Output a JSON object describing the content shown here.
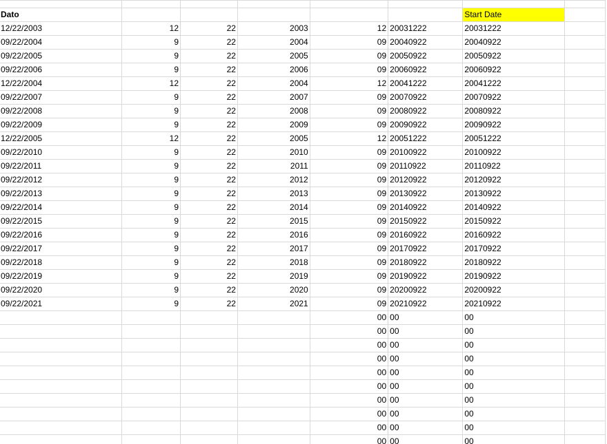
{
  "sheet": {
    "col_a_header": "Dato",
    "col_g_header": "Start Date",
    "highlight_color": "#ffff00",
    "rows": [
      {
        "a": "12/22/2003",
        "b": "12",
        "c": "22",
        "d": "2003",
        "e": "12",
        "f": "20031222",
        "g": "20031222"
      },
      {
        "a": "09/22/2004",
        "b": "9",
        "c": "22",
        "d": "2004",
        "e": "09",
        "f": "20040922",
        "g": "20040922"
      },
      {
        "a": "09/22/2005",
        "b": "9",
        "c": "22",
        "d": "2005",
        "e": "09",
        "f": "20050922",
        "g": "20050922"
      },
      {
        "a": "09/22/2006",
        "b": "9",
        "c": "22",
        "d": "2006",
        "e": "09",
        "f": "20060922",
        "g": "20060922"
      },
      {
        "a": "12/22/2004",
        "b": "12",
        "c": "22",
        "d": "2004",
        "e": "12",
        "f": "20041222",
        "g": "20041222"
      },
      {
        "a": "09/22/2007",
        "b": "9",
        "c": "22",
        "d": "2007",
        "e": "09",
        "f": "20070922",
        "g": "20070922"
      },
      {
        "a": "09/22/2008",
        "b": "9",
        "c": "22",
        "d": "2008",
        "e": "09",
        "f": "20080922",
        "g": "20080922"
      },
      {
        "a": "09/22/2009",
        "b": "9",
        "c": "22",
        "d": "2009",
        "e": "09",
        "f": "20090922",
        "g": "20090922"
      },
      {
        "a": "12/22/2005",
        "b": "12",
        "c": "22",
        "d": "2005",
        "e": "12",
        "f": "20051222",
        "g": "20051222"
      },
      {
        "a": "09/22/2010",
        "b": "9",
        "c": "22",
        "d": "2010",
        "e": "09",
        "f": "20100922",
        "g": "20100922"
      },
      {
        "a": "09/22/2011",
        "b": "9",
        "c": "22",
        "d": "2011",
        "e": "09",
        "f": "20110922",
        "g": "20110922"
      },
      {
        "a": "09/22/2012",
        "b": "9",
        "c": "22",
        "d": "2012",
        "e": "09",
        "f": "20120922",
        "g": "20120922"
      },
      {
        "a": "09/22/2013",
        "b": "9",
        "c": "22",
        "d": "2013",
        "e": "09",
        "f": "20130922",
        "g": "20130922"
      },
      {
        "a": "09/22/2014",
        "b": "9",
        "c": "22",
        "d": "2014",
        "e": "09",
        "f": "20140922",
        "g": "20140922"
      },
      {
        "a": "09/22/2015",
        "b": "9",
        "c": "22",
        "d": "2015",
        "e": "09",
        "f": "20150922",
        "g": "20150922"
      },
      {
        "a": "09/22/2016",
        "b": "9",
        "c": "22",
        "d": "2016",
        "e": "09",
        "f": "20160922",
        "g": "20160922"
      },
      {
        "a": "09/22/2017",
        "b": "9",
        "c": "22",
        "d": "2017",
        "e": "09",
        "f": "20170922",
        "g": "20170922"
      },
      {
        "a": "09/22/2018",
        "b": "9",
        "c": "22",
        "d": "2018",
        "e": "09",
        "f": "20180922",
        "g": "20180922"
      },
      {
        "a": "09/22/2019",
        "b": "9",
        "c": "22",
        "d": "2019",
        "e": "09",
        "f": "20190922",
        "g": "20190922"
      },
      {
        "a": "09/22/2020",
        "b": "9",
        "c": "22",
        "d": "2020",
        "e": "09",
        "f": "20200922",
        "g": "20200922"
      },
      {
        "a": "09/22/2021",
        "b": "9",
        "c": "22",
        "d": "2021",
        "e": "09",
        "f": "20210922",
        "g": "20210922"
      },
      {
        "a": "",
        "b": "",
        "c": "",
        "d": "",
        "e": "00",
        "f": "00",
        "g": "00"
      },
      {
        "a": "",
        "b": "",
        "c": "",
        "d": "",
        "e": "00",
        "f": "00",
        "g": "00"
      },
      {
        "a": "",
        "b": "",
        "c": "",
        "d": "",
        "e": "00",
        "f": "00",
        "g": "00"
      },
      {
        "a": "",
        "b": "",
        "c": "",
        "d": "",
        "e": "00",
        "f": "00",
        "g": "00"
      },
      {
        "a": "",
        "b": "",
        "c": "",
        "d": "",
        "e": "00",
        "f": "00",
        "g": "00"
      },
      {
        "a": "",
        "b": "",
        "c": "",
        "d": "",
        "e": "00",
        "f": "00",
        "g": "00"
      },
      {
        "a": "",
        "b": "",
        "c": "",
        "d": "",
        "e": "00",
        "f": "00",
        "g": "00"
      },
      {
        "a": "",
        "b": "",
        "c": "",
        "d": "",
        "e": "00",
        "f": "00",
        "g": "00"
      },
      {
        "a": "",
        "b": "",
        "c": "",
        "d": "",
        "e": "00",
        "f": "00",
        "g": "00"
      },
      {
        "a": "",
        "b": "",
        "c": "",
        "d": "",
        "e": "00",
        "f": "00",
        "g": "00"
      }
    ]
  }
}
